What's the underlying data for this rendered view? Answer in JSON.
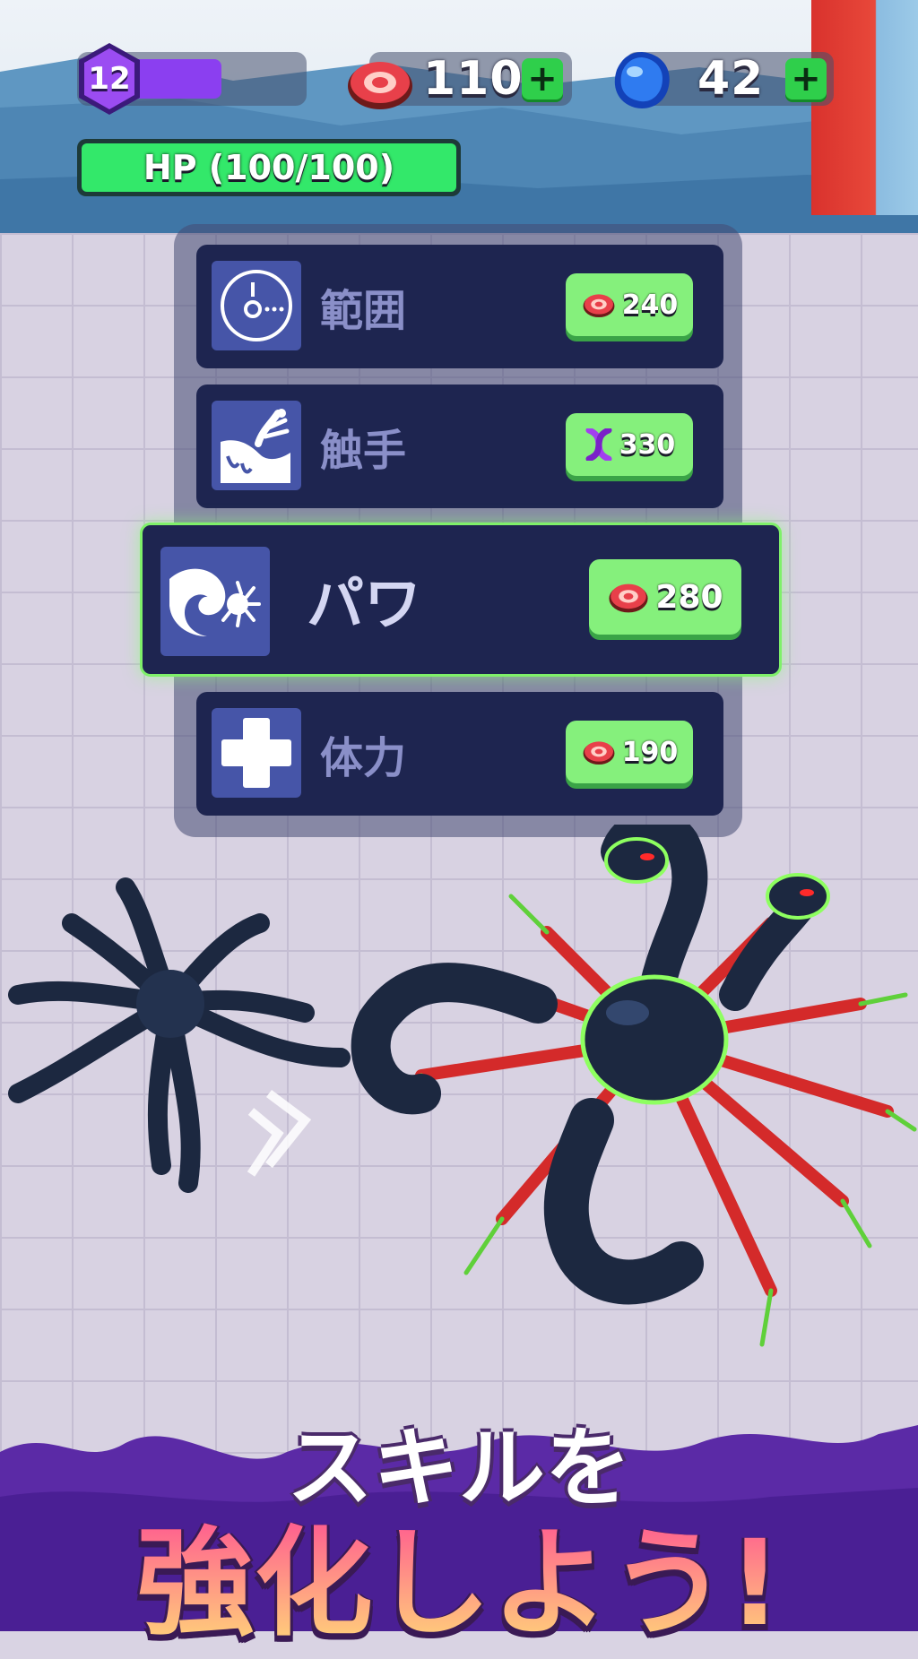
{
  "hud": {
    "level": "12",
    "level_progress": 0.55,
    "meat": {
      "icon": "meat-icon",
      "value": "110"
    },
    "gems": {
      "icon": "blue-gem-icon",
      "value": "42"
    },
    "plus_label": "+",
    "hp_label": "HP (100/100)",
    "hp_fraction": 1.0
  },
  "upgrades": [
    {
      "icon": "range-icon",
      "label": "範囲",
      "cost_icon": "meat-icon",
      "cost": "240"
    },
    {
      "icon": "tentacle-icon",
      "label": "触手",
      "cost_icon": "dna-icon",
      "cost": "330"
    },
    {
      "icon": "power-icon",
      "label": "パワ",
      "cost_icon": "meat-icon",
      "cost": "280"
    },
    {
      "icon": "health-cross-icon",
      "label": "体力",
      "cost_icon": "meat-icon",
      "cost": "190"
    }
  ],
  "banner": {
    "line1": "スキルを",
    "line2": "強化しよう!"
  },
  "colors": {
    "level_purple": "#8b3ff0",
    "hp_green": "#33e86a",
    "row_navy": "#1e2550",
    "price_green": "#85f07c",
    "banner_purple": "#5b2aa6"
  }
}
